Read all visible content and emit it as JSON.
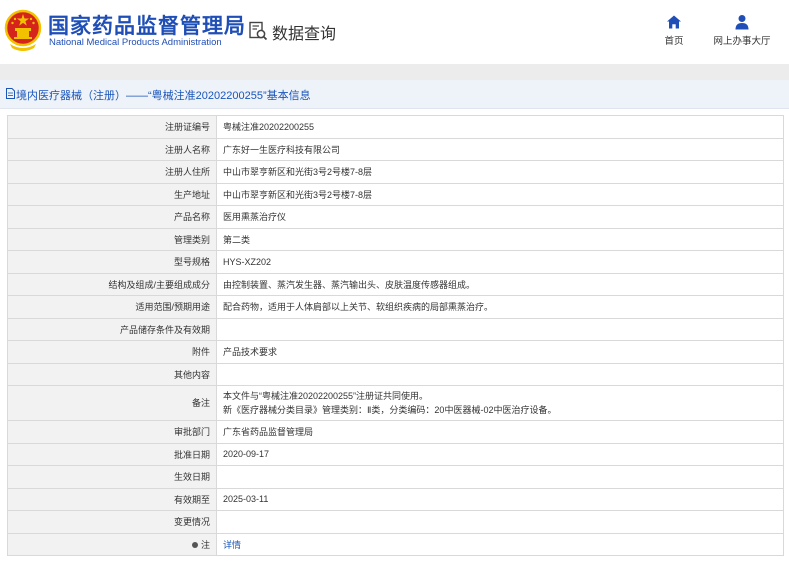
{
  "header": {
    "site_name_cn": "国家药品监督管理局",
    "site_name_en": "National Medical Products Administration",
    "page_title": "数据查询",
    "nav": [
      {
        "label": "首页",
        "icon": "home-icon"
      },
      {
        "label": "网上办事大厅",
        "icon": "user-icon"
      }
    ]
  },
  "section": {
    "title": "境内医疗器械（注册）——“粤械注准20202200255”基本信息"
  },
  "rows": [
    {
      "label": "注册证编号",
      "value": "粤械注准20202200255"
    },
    {
      "label": "注册人名称",
      "value": "广东好一生医疗科技有限公司"
    },
    {
      "label": "注册人住所",
      "value": "中山市翠亨新区和光街3号2号楼7-8层"
    },
    {
      "label": "生产地址",
      "value": "中山市翠亨新区和光街3号2号楼7-8层"
    },
    {
      "label": "产品名称",
      "value": "医用熏蒸治疗仪"
    },
    {
      "label": "管理类别",
      "value": "第二类"
    },
    {
      "label": "型号规格",
      "value": "HYS-XZ202"
    },
    {
      "label": "结构及组成/主要组成成分",
      "value": "由控制装置、蒸汽发生器、蒸汽输出头、皮肤温度传感器组成。"
    },
    {
      "label": "适用范围/预期用途",
      "value": "配合药物，适用于人体肩部以上关节、软组织疾病的局部熏蒸治疗。"
    },
    {
      "label": "产品储存条件及有效期",
      "value": ""
    },
    {
      "label": "附件",
      "value": "产品技术要求"
    },
    {
      "label": "其他内容",
      "value": ""
    },
    {
      "label": "备注",
      "value_line1": "本文件与“粤械注准20202200255”注册证共同使用。",
      "value_line2": "新《医疗器械分类目录》管理类别：Ⅱ类，分类编码：20中医器械-02中医治疗设备。"
    },
    {
      "label": "审批部门",
      "value": "广东省药品监督管理局"
    },
    {
      "label": "批准日期",
      "value": "2020-09-17"
    },
    {
      "label": "生效日期",
      "value": ""
    },
    {
      "label": "有效期至",
      "value": "2025-03-11"
    },
    {
      "label": "变更情况",
      "value": ""
    },
    {
      "label": "注",
      "value": "详情"
    }
  ],
  "colors": {
    "brand_blue": "#1f4fb6",
    "link_blue": "#1a56b8",
    "label_bg": "#f2f2f2",
    "emblem_red": "#d4241c",
    "emblem_gold": "#f2c200"
  }
}
